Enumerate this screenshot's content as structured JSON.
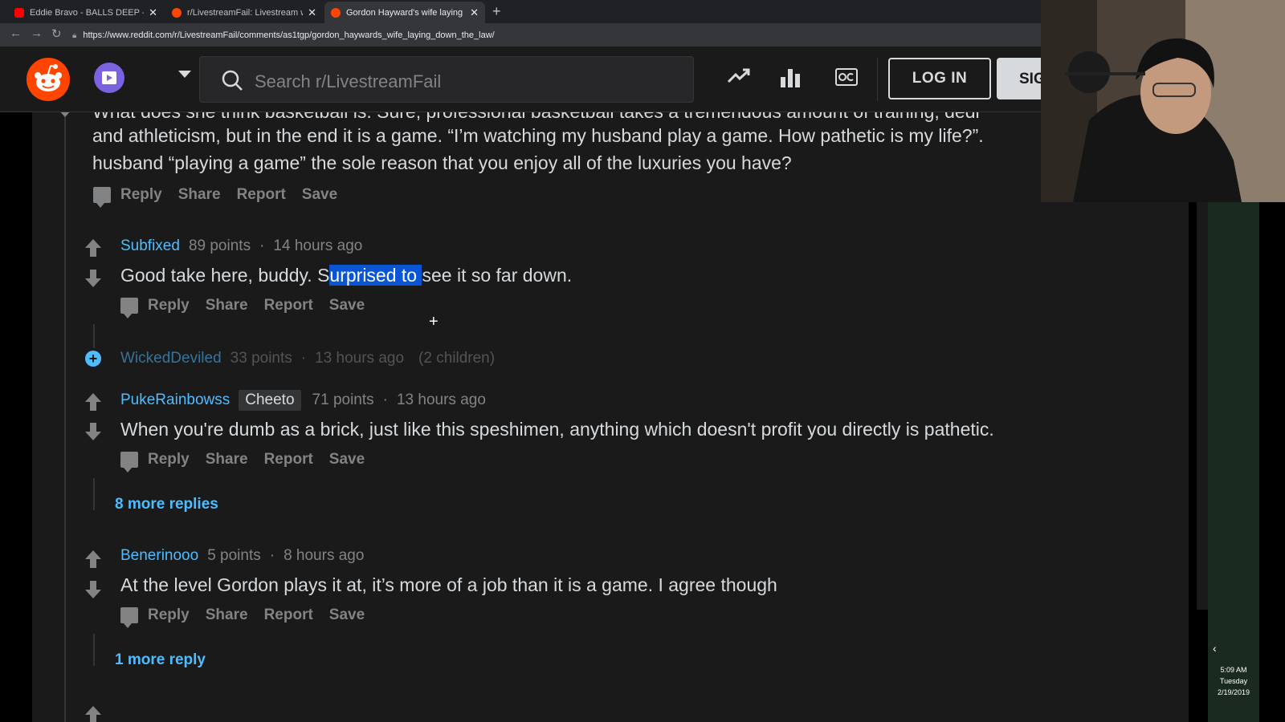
{
  "browser": {
    "tabs": [
      {
        "title": "Eddie Bravo - BALLS DEEP - Flat E",
        "active": false,
        "favicon": "youtube-favicon"
      },
      {
        "title": "r/LivestreamFail: Livestream win",
        "active": false,
        "favicon": "reddit-favicon"
      },
      {
        "title": "Gordon Hayward's wife laying do",
        "active": true,
        "favicon": "reddit-favicon"
      }
    ],
    "new_tab": "+",
    "url": "https://www.reddit.com/r/LivestreamFail/comments/as1tgp/gordon_haywards_wife_laying_down_the_law/"
  },
  "header": {
    "search_placeholder": "Search r/LivestreamFail",
    "login_label": "LOG IN",
    "signup_label": "SIGN UP"
  },
  "comments": {
    "top": {
      "line1": "What does she think basketball is. Sure, professional basketball takes a tremendous amount of training, dedi",
      "line2": "and athleticism, but in the end it is a game. “I’m watching my husband play a game. How pathetic is my life?”.",
      "line3": "husband “playing a game” the sole reason that you enjoy all of the luxuries you have?"
    },
    "subfixed": {
      "user": "Subfixed",
      "points": "89 points",
      "time": "14 hours ago",
      "text_before": "Good take here, buddy. S",
      "text_highlight": "urprised to ",
      "text_after": "see it so far down."
    },
    "wicked": {
      "user": "WickedDeviled",
      "points": "33 points",
      "time": "13 hours ago",
      "children": "(2 children)"
    },
    "puke": {
      "user": "PukeRainbowss",
      "flair": "Cheeto",
      "points": "71 points",
      "time": "13 hours ago",
      "text": "When you're dumb as a brick, just like this speshimen, anything which doesn't profit you directly is pathetic.",
      "more": "8 more replies"
    },
    "bener": {
      "user": "Benerinooo",
      "points": "5 points",
      "time": "8 hours ago",
      "text": "At the level Gordon plays it at, it’s more of a job than it is a game. I agree though",
      "more": "1 more reply"
    }
  },
  "actions": {
    "reply": "Reply",
    "share": "Share",
    "report": "Report",
    "save": "Save"
  },
  "meta_separator": "·",
  "taskbar_clock": {
    "time": "5:09 AM",
    "day": "Tuesday",
    "date": "2/19/2019"
  },
  "colors": {
    "reddit_orange": "#ff4500",
    "username_blue": "#4fbcff",
    "panel_bg": "#1a1a1b",
    "text": "#d7dadc",
    "muted": "#818384",
    "selection": "#0a55d6"
  }
}
